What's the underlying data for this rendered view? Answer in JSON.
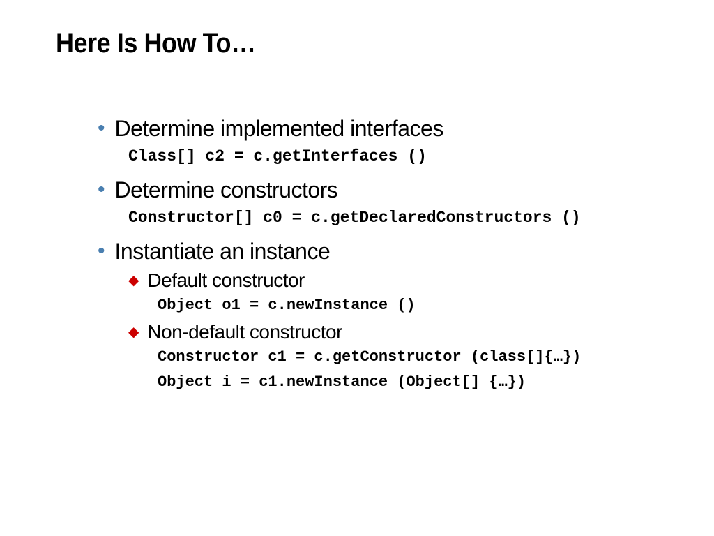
{
  "slide": {
    "title": "Here Is How To…",
    "items": [
      {
        "text": "Determine implemented interfaces",
        "code": "Class[] c2 = c.getInterfaces ()"
      },
      {
        "text": "Determine constructors",
        "code": "Constructor[] c0 = c.getDeclaredConstructors ()"
      },
      {
        "text": "Instantiate an instance",
        "subitems": [
          {
            "text": "Default constructor",
            "code": [
              "Object o1 = c.newInstance ()"
            ]
          },
          {
            "text": "Non-default constructor",
            "code": [
              "Constructor c1 = c.getConstructor (class[]{…})",
              "Object i = c1.newInstance (Object[] {…})"
            ]
          }
        ]
      }
    ]
  }
}
